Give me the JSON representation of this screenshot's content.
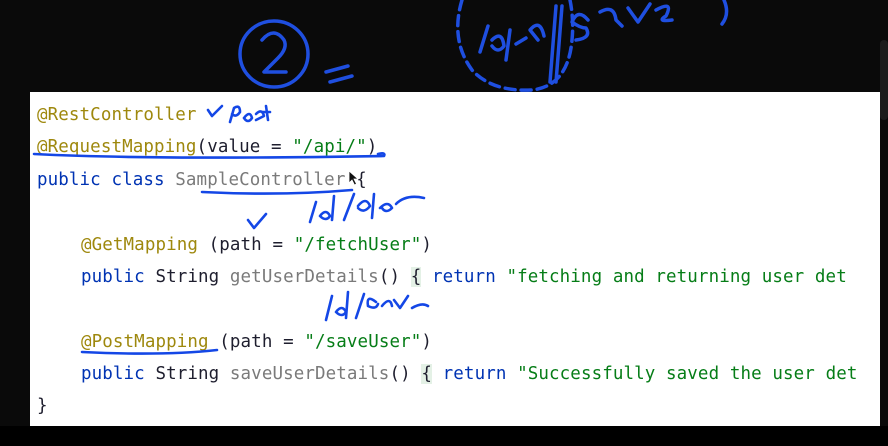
{
  "code": {
    "line1": {
      "annotation": "@RestController"
    },
    "line2": {
      "annotation": "@RequestMapping",
      "open": "(",
      "attr": "value",
      "eq": " = ",
      "value": "\"/api/\"",
      "close": ")"
    },
    "line3": {
      "kw": "public class ",
      "cls": "SampleController",
      "rest": " {"
    },
    "line5": {
      "annotation": "@GetMapping",
      "open": " (path = ",
      "value": "\"/fetchUser\"",
      "close": ")"
    },
    "line6": {
      "kw1": "public ",
      "type": "String ",
      "fn": "getUserDetails",
      "paren": "() ",
      "brace": "{",
      "sp": " ",
      "kw2": "return",
      "sp2": " ",
      "value": "\"fetching and returning user det"
    },
    "line8": {
      "annotation": "@PostMapping",
      "open": " (path = ",
      "value": "\"/saveUser\"",
      "close": ")"
    },
    "line9": {
      "kw1": "public ",
      "type": "String ",
      "fn": "saveUserDetails",
      "paren": "() ",
      "brace": "{",
      "sp": " ",
      "kw2": "return",
      "sp2": " ",
      "value": "\"Successfully saved the user det"
    },
    "line10": {
      "brace": "}"
    }
  },
  "colors": {
    "annotation": "#9e880d",
    "string": "#067d17",
    "keyword": "#0033b3",
    "ink": "#1447e6"
  },
  "icons": [
    "mouse-cursor-icon"
  ]
}
